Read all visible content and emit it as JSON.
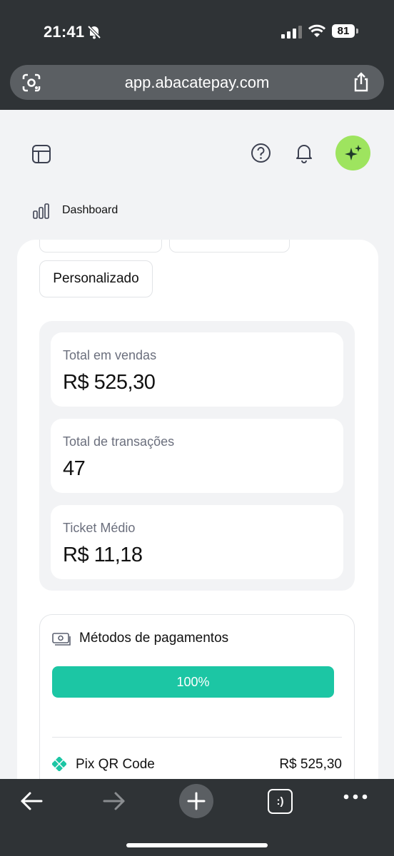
{
  "status": {
    "time": "21:41",
    "battery": "81"
  },
  "browser": {
    "url": "app.abacatepay.com",
    "tabs_label": ":)"
  },
  "breadcrumb": {
    "label": "Dashboard"
  },
  "filters": {
    "custom_label": "Personalizado"
  },
  "stats": [
    {
      "label": "Total em vendas",
      "value": "R$ 525,30"
    },
    {
      "label": "Total de transações",
      "value": "47"
    },
    {
      "label": "Ticket Médio",
      "value": "R$ 11,18"
    }
  ],
  "payments": {
    "title": "Métodos de pagamentos",
    "progress_label": "100%",
    "progress_fraction": 1.0,
    "methods": [
      {
        "name": "Pix QR Code",
        "value": "R$ 525,30"
      }
    ]
  },
  "colors": {
    "accent": "#1cc6a4",
    "ai_button": "#9ee45f",
    "chrome": "#2f3336"
  },
  "icons": [
    "bell-slash-icon",
    "signal-icon",
    "wifi-icon",
    "battery-icon",
    "camera-lens-icon",
    "share-icon",
    "sidebar-icon",
    "help-icon",
    "bell-icon",
    "sparkles-icon",
    "bar-chart-icon",
    "money-icon",
    "pix-icon",
    "back-arrow-icon",
    "forward-arrow-icon",
    "plus-icon",
    "ellipsis-icon"
  ]
}
